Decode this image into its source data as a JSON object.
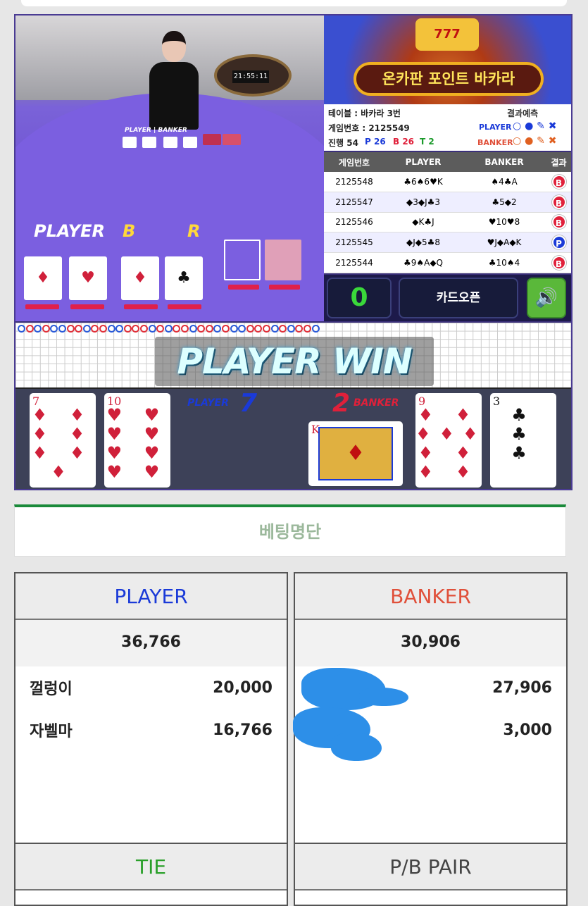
{
  "video": {
    "clock": "21:55:11",
    "felt_player": "PLAYER",
    "felt_banker": "B",
    "felt_banker_end": "R",
    "felt_small": "PLAYER | BANKER"
  },
  "banner": {
    "title": "온카판 포인트 바카라",
    "slot": "777"
  },
  "info": {
    "table": "테이블 : 바카라 3번",
    "predict": "결과예측",
    "game_no": "게임번호 : 2125549",
    "player_label": "PLAYER",
    "banker_label": "BANKER",
    "progress": "진행 54",
    "p": "P 26",
    "b": "B 26",
    "t": "T 2"
  },
  "results": {
    "headers": [
      "게임번호",
      "PLAYER",
      "BANKER",
      "결과"
    ],
    "rows": [
      {
        "id": "2125548",
        "player": "♣6♠6♥K",
        "banker": "♠4♣A",
        "result": "B"
      },
      {
        "id": "2125547",
        "player": "◆3◆J♣3",
        "banker": "♣5◆2",
        "result": "B"
      },
      {
        "id": "2125546",
        "player": "◆K♣J",
        "banker": "♥10♥8",
        "result": "B"
      },
      {
        "id": "2125545",
        "player": "◆J◆5♣8",
        "banker": "♥J◆A◆K",
        "result": "P"
      },
      {
        "id": "2125544",
        "player": "♣9♠A◆Q",
        "banker": "♣10♠4",
        "result": "B"
      }
    ]
  },
  "controls": {
    "timer": "0",
    "open": "카드오픈"
  },
  "win_text": "PLAYER WIN",
  "deal": {
    "player_label": "PLAYER",
    "player_score": "7",
    "banker_label": "BANKER",
    "banker_score": "2",
    "player_cards": [
      "7",
      "10"
    ],
    "banker_cards": [
      "K",
      "9",
      "3"
    ]
  },
  "betlist_title": "베팅명단",
  "player_panel": {
    "title": "PLAYER",
    "total": "36,766",
    "rows": [
      {
        "name": "껄렁이",
        "amount": "20,000"
      },
      {
        "name": "자벨마",
        "amount": "16,766"
      }
    ]
  },
  "banker_panel": {
    "title": "BANKER",
    "total": "30,906",
    "rows": [
      {
        "name": "",
        "amount": "27,906"
      },
      {
        "name": "",
        "amount": "3,000"
      }
    ]
  },
  "tie_panel": {
    "title": "TIE"
  },
  "pair_panel": {
    "title": "P/B PAIR"
  },
  "colors": {
    "player_blue": "#1a3ad8",
    "banker_red": "#e0503a",
    "tie_green": "#2aa02a",
    "accent_green": "#1a8a3a"
  }
}
